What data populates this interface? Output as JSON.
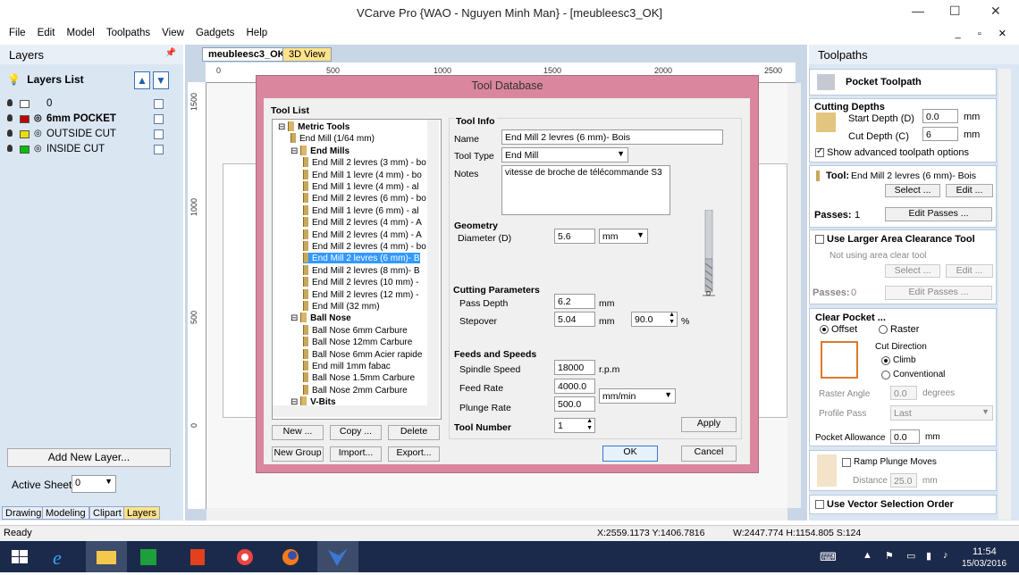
{
  "window": {
    "title": "VCarve Pro {WAO - Nguyen Minh Man} - [meubleesc3_OK]",
    "min": "—",
    "max": "☐",
    "close": "✕"
  },
  "menu": [
    "File",
    "Edit",
    "Model",
    "Toolpaths",
    "View",
    "Gadgets",
    "Help"
  ],
  "mdi_controls": "_ ▫ ✕",
  "left_panel": {
    "title": "Layers",
    "list_title": "Layers List",
    "layers": [
      {
        "name": "0",
        "color": "#ffffff"
      },
      {
        "name": "6mm POCKET",
        "color": "#c00000",
        "bold": true
      },
      {
        "name": "OUTSIDE CUT",
        "color": "#e8e000"
      },
      {
        "name": "INSIDE CUT",
        "color": "#00c000"
      }
    ],
    "add_layer": "Add New Layer...",
    "active_sheet_label": "Active Sheet:",
    "active_sheet_value": "0",
    "tabs": [
      "Drawing",
      "Modeling",
      "Clipart",
      "Layers"
    ]
  },
  "doc": {
    "tabs": [
      "meubleesc3_OK",
      "3D View"
    ],
    "ruler_h": [
      "0",
      "500",
      "1000",
      "1500",
      "2000",
      "2500"
    ],
    "ruler_v": [
      "1500",
      "1000",
      "500",
      "0"
    ]
  },
  "right_panel": {
    "title": "Toolpaths",
    "pocket_title": "Pocket Toolpath",
    "cutting_depths": "Cutting Depths",
    "start_depth_label": "Start Depth (D)",
    "start_depth": "0.0",
    "cut_depth_label": "Cut Depth (C)",
    "cut_depth": "6",
    "unit": "mm",
    "advanced": "Show advanced toolpath options",
    "tool_label": "Tool:",
    "tool_name": "End Mill 2 levres (6 mm)- Bois",
    "select": "Select ...",
    "edit": "Edit ...",
    "passes_label": "Passes:",
    "passes": "1",
    "edit_passes": "Edit Passes ...",
    "larger_area": "Use Larger Area Clearance Tool",
    "not_using": "Not using area clear tool",
    "select2": "Select ...",
    "edit2": "Edit ...",
    "passes2_label": "Passes:",
    "passes2": "0",
    "edit_passes2": "Edit Passes ...",
    "clear_pocket": "Clear Pocket ...",
    "offset": "Offset",
    "raster": "Raster",
    "cut_direction": "Cut Direction",
    "climb": "Climb",
    "conventional": "Conventional",
    "raster_angle_label": "Raster Angle",
    "raster_angle": "0.0",
    "degrees": "degrees",
    "profile_pass_label": "Profile Pass",
    "profile_pass": "Last",
    "pocket_allowance_label": "Pocket Allowance",
    "pocket_allowance": "0.0",
    "ramp": "Ramp Plunge Moves",
    "distance_label": "Distance",
    "distance": "25.0",
    "vector_order": "Use Vector Selection Order"
  },
  "dialog": {
    "title": "Tool Database",
    "tool_list_label": "Tool List",
    "tree": [
      {
        "t": "Metric Tools",
        "lvl": 0,
        "bold": true
      },
      {
        "t": "End Mill (1/64 mm)",
        "lvl": 1
      },
      {
        "t": "End Mills",
        "lvl": 1,
        "bold": true
      },
      {
        "t": "End Mill 2 levres (3 mm) - bo",
        "lvl": 2
      },
      {
        "t": "End Mill 1 levre (4 mm) - bo",
        "lvl": 2
      },
      {
        "t": "End Mill 1 levre (4 mm) - al",
        "lvl": 2
      },
      {
        "t": "End Mill 2 levres (6 mm) - bo",
        "lvl": 2
      },
      {
        "t": "End Mill 1 levre (6 mm) - al",
        "lvl": 2
      },
      {
        "t": "End Mill 2 levres (4 mm) - A",
        "lvl": 2
      },
      {
        "t": "End Mill 2 levres (4 mm) - A",
        "lvl": 2
      },
      {
        "t": "End Mill 2 levres (4 mm) - bo",
        "lvl": 2
      },
      {
        "t": "End Mill 2 levres (6 mm)- B",
        "lvl": 2,
        "selected": true
      },
      {
        "t": "End Mill 2 levres (8 mm)- B",
        "lvl": 2
      },
      {
        "t": "End Mill 2 levres (10 mm) -",
        "lvl": 2
      },
      {
        "t": "End Mill 2 levres (12 mm) -",
        "lvl": 2
      },
      {
        "t": "End Mill (32 mm)",
        "lvl": 2
      },
      {
        "t": "Ball Nose",
        "lvl": 1,
        "bold": true
      },
      {
        "t": "Ball Nose 6mm Carbure",
        "lvl": 2
      },
      {
        "t": "Ball Nose 12mm Carbure",
        "lvl": 2
      },
      {
        "t": "Ball Nose 6mm Acier rapide",
        "lvl": 2
      },
      {
        "t": "End mill 1mm fabac",
        "lvl": 2
      },
      {
        "t": "Ball Nose 1.5mm Carbure",
        "lvl": 2
      },
      {
        "t": "Ball Nose 2mm Carbure",
        "lvl": 2
      },
      {
        "t": "V-Bits",
        "lvl": 1,
        "bold": true
      }
    ],
    "buttons": {
      "new": "New ...",
      "copy": "Copy ...",
      "delete": "Delete",
      "new_group": "New Group",
      "import": "Import...",
      "export": "Export...",
      "ok": "OK",
      "cancel": "Cancel",
      "apply": "Apply"
    },
    "tool_info": "Tool Info",
    "name_label": "Name",
    "name": "End Mill 2 levres (6 mm)- Bois",
    "type_label": "Tool Type",
    "type": "End Mill",
    "notes_label": "Notes",
    "notes": "vitesse de broche de télécommande S3",
    "geometry": "Geometry",
    "diameter_label": "Diameter (D)",
    "diameter": "5.6",
    "diameter_unit": "mm",
    "cutting_params": "Cutting Parameters",
    "pass_depth_label": "Pass Depth",
    "pass_depth": "6.2",
    "pass_unit": "mm",
    "stepover_label": "Stepover",
    "stepover": "5.04",
    "stepover_unit": "mm",
    "stepover_pct": "90.0",
    "pct": "%",
    "feeds": "Feeds and Speeds",
    "spindle_label": "Spindle Speed",
    "spindle": "18000",
    "rpm": "r.p.m",
    "feed_label": "Feed Rate",
    "feed": "4000.0",
    "feed_unit": "mm/min",
    "plunge_label": "Plunge Rate",
    "plunge": "500.0",
    "tool_number_label": "Tool Number",
    "tool_number": "1",
    "d_label": "D"
  },
  "status": {
    "ready": "Ready",
    "coords": "X:2559.1173 Y:1406.7816",
    "size": "W:2447.774  H:1154.805  S:124"
  },
  "taskbar": {
    "time": "11:54",
    "date": "15/03/2016"
  }
}
